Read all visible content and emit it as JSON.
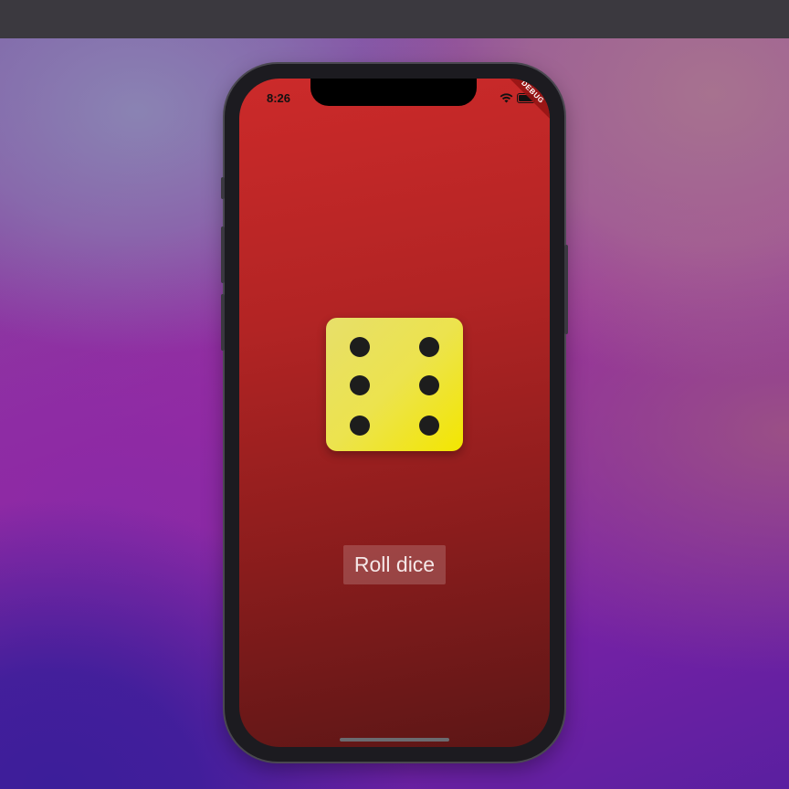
{
  "status_bar": {
    "time": "8:26",
    "debug_label": "DEBUG"
  },
  "dice": {
    "face_value": 6
  },
  "roll_button": {
    "label": "Roll dice"
  },
  "icons": {
    "wifi": "wifi-icon",
    "battery": "battery-icon"
  },
  "colors": {
    "screen_gradient_top": "#cc2a2a",
    "screen_gradient_bottom": "#5c1616",
    "dice_face": "#ece34e",
    "pip": "#1d1d1d"
  }
}
